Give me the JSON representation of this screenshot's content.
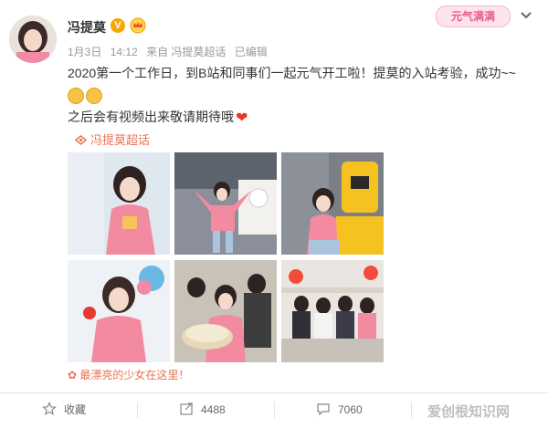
{
  "header": {
    "username": "冯提莫",
    "badge_text": "元气满满",
    "meta": {
      "date": "1月3日",
      "time": "14:12",
      "source": "来自 冯提莫超话",
      "edited": "已编辑"
    }
  },
  "post": {
    "line1": "2020第一个工作日，到B站和同事们一起元气开工啦！提莫的入站考验，成功~~",
    "line2": "之后会有视频出来敬请期待哦",
    "topic": "冯提莫超话",
    "location_tag": "最漂亮的少女在这里！"
  },
  "actions": {
    "favorite": "收藏",
    "repost_count": "4488",
    "comment_count": "7060"
  },
  "watermark": "爱创根知识网",
  "colors": {
    "accent_orange": "#eb7350",
    "badge_pink": "#e85c8a",
    "vip_gold": "#f7a600",
    "heart_red": "#e8342c"
  },
  "icons": [
    "avatar",
    "vip-icon",
    "crown-icon",
    "chevron-down-icon",
    "grin-emoji",
    "heart-icon",
    "chaohua-icon",
    "star-icon",
    "repost-icon",
    "comment-icon"
  ]
}
